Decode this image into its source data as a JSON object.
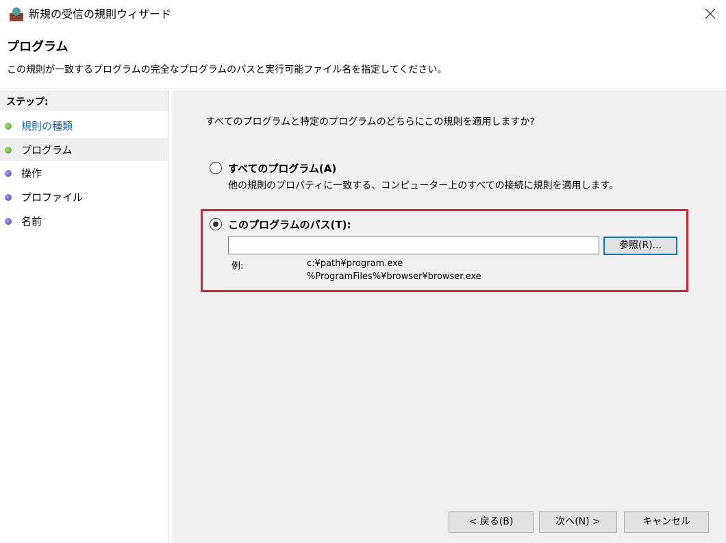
{
  "window": {
    "title": "新規の受信の規則ウィザード"
  },
  "header": {
    "title": "プログラム",
    "subtitle": "この規則が一致するプログラムの完全なプログラムのパスと実行可能ファイル名を指定してください。"
  },
  "sidebar": {
    "header": "ステップ:",
    "steps": [
      {
        "label": "規則の種類",
        "status": "completed",
        "color": "#3fa027"
      },
      {
        "label": "プログラム",
        "status": "current",
        "color": "#3fa027"
      },
      {
        "label": "操作",
        "status": "pending",
        "color": "#4a3fc0"
      },
      {
        "label": "プロファイル",
        "status": "pending",
        "color": "#4a3fc0"
      },
      {
        "label": "名前",
        "status": "pending",
        "color": "#4a3fc0"
      }
    ]
  },
  "main": {
    "question": "すべてのプログラムと特定のプログラムのどちらにこの規則を適用しますか?",
    "option_all": {
      "label": "すべてのプログラム(A)",
      "description": "他の規則のプロパティに一致する、コンピューター上のすべての接続に規則を適用します。",
      "selected": false
    },
    "option_path": {
      "label": "このプログラムのパス(T):",
      "selected": true,
      "value": "",
      "browse_label": "参照(R)...",
      "example_label": "例:",
      "examples": [
        "c:¥path¥program.exe",
        "%ProgramFiles%¥browser¥browser.exe"
      ]
    },
    "highlight_color": "#e0202a"
  },
  "footer": {
    "back_label": "< 戻る(B)",
    "next_label": "次へ(N) >",
    "cancel_label": "キャンセル"
  }
}
